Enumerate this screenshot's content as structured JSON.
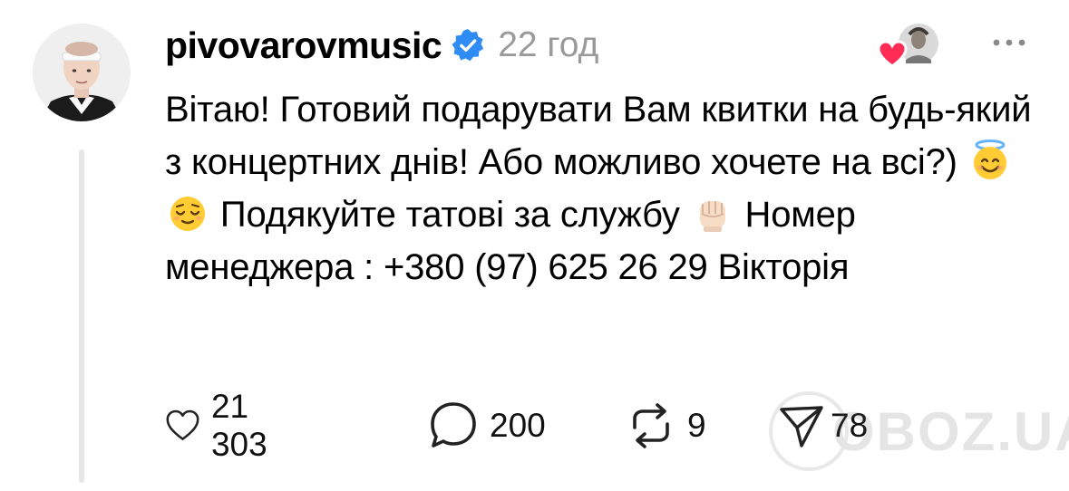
{
  "post": {
    "username": "pivovarovmusic",
    "verified": true,
    "time": "22 год",
    "text": "Вітаю! Готовий подарувати Вам квитки на будь-який з концертних днів! Або можливо хочете на всі?) 😇 😌 Подякуйте татові за службу ✊🏻 Номер менеджера : +380 (97) 625 26 29 Вікторія",
    "text_parts": [
      "Вітаю! Готовий подарувати Вам квитки на будь-який з концертних днів! Або можливо хочете на всі?)",
      "Подякуйте татові за службу",
      "Номер менеджера : +380 (97) 625 26 29 Вікторія"
    ],
    "emojis": [
      "smiling-face-with-halo",
      "relieved-face",
      "raised-fist-light-skin-tone"
    ]
  },
  "actions": {
    "likes": "21 303",
    "replies": "200",
    "reposts": "9",
    "shares": "78"
  },
  "watermark": "OBOZ.UA",
  "colors": {
    "verified_blue": "#2f8cf5",
    "heart_red": "#ff2d55",
    "secondary_text": "#9a9a9a",
    "thread_line": "#e6e6e6"
  },
  "icons": [
    "verified-badge-icon",
    "liked-heart-icon",
    "more-icon",
    "heart-icon",
    "comment-icon",
    "repost-icon",
    "share-icon"
  ]
}
